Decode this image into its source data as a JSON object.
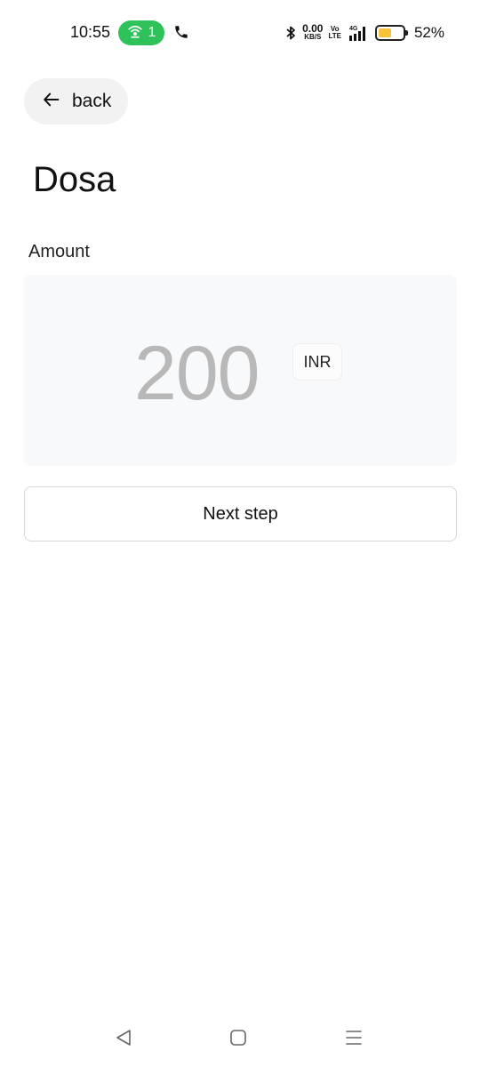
{
  "status_bar": {
    "time": "10:55",
    "hotspot_count": "1",
    "net_speed_value": "0.00",
    "net_speed_unit": "KB/S",
    "volte_top": "Vo",
    "volte_bottom": "LTE",
    "network": "4G",
    "battery_percent": "52%",
    "battery_level": 0.52,
    "hotspot_color": "#2fc15a",
    "battery_color": "#f6c33a"
  },
  "header": {
    "back_label": "back",
    "title": "Dosa"
  },
  "form": {
    "amount_label": "Amount",
    "amount_value": "200",
    "currency": "INR",
    "next_label": "Next step"
  },
  "icons": {
    "back": "arrow-left-icon",
    "nav_back": "triangle-back-icon",
    "nav_home": "square-home-icon",
    "nav_recents": "menu-lines-icon"
  }
}
